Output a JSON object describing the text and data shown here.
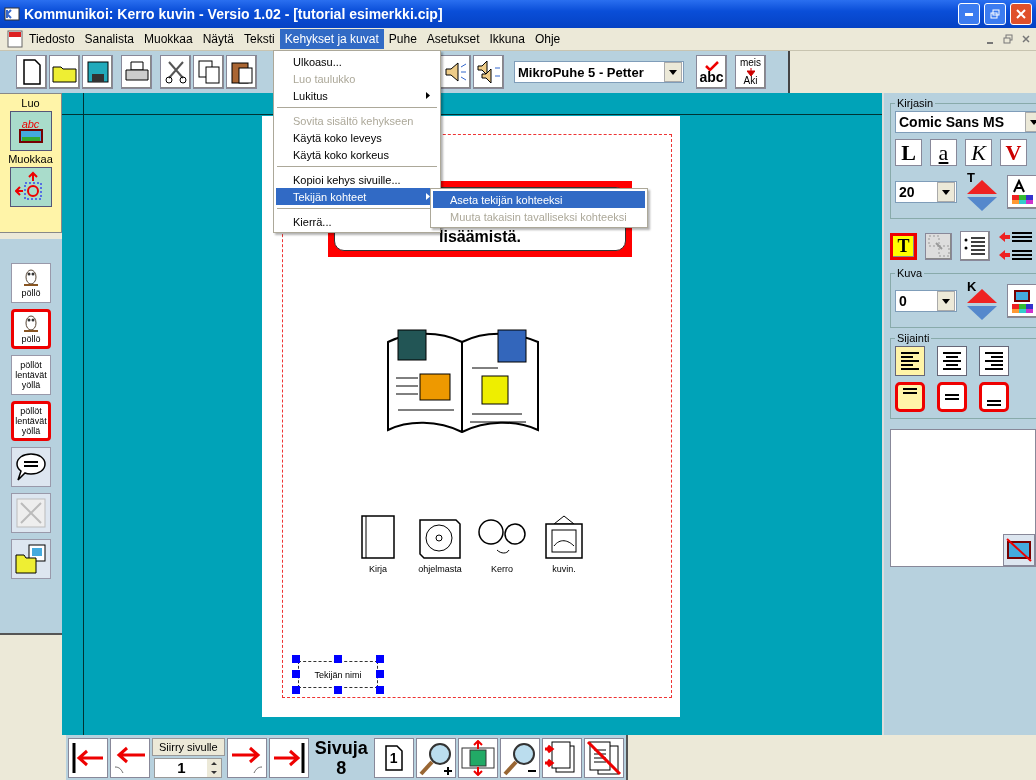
{
  "window": {
    "title": "Kommunikoi: Kerro kuvin - Versio 1.02 - [tutorial esimerkki.cip]"
  },
  "menu_bar": [
    {
      "label": "Tiedosto",
      "selected": false
    },
    {
      "label": "Sanalista",
      "selected": false
    },
    {
      "label": "Muokkaa",
      "selected": false
    },
    {
      "label": "Näytä",
      "selected": false
    },
    {
      "label": "Teksti",
      "selected": false
    },
    {
      "label": "Kehykset ja kuvat",
      "selected": true
    },
    {
      "label": "Puhe",
      "selected": false
    },
    {
      "label": "Asetukset",
      "selected": false
    },
    {
      "label": "Ikkuna",
      "selected": false
    },
    {
      "label": "Ohje",
      "selected": false
    }
  ],
  "toolbar": {
    "voice": "MikroPuhe 5 - Petter",
    "spell_label": "abc",
    "swap_top": "meis",
    "swap_bottom": "Aki"
  },
  "menu": [
    {
      "kind": "item",
      "label": "Ulkoasu...",
      "disabled": false,
      "submenu": false,
      "selected": false
    },
    {
      "kind": "item",
      "label": "Luo taulukko",
      "disabled": true,
      "submenu": false,
      "selected": false
    },
    {
      "kind": "item",
      "label": "Lukitus",
      "disabled": false,
      "submenu": true,
      "selected": false
    },
    {
      "kind": "separator"
    },
    {
      "kind": "item",
      "label": "Sovita sisältö kehykseen",
      "disabled": true,
      "submenu": false,
      "selected": false
    },
    {
      "kind": "item",
      "label": "Käytä koko leveys",
      "disabled": false,
      "submenu": false,
      "selected": false
    },
    {
      "kind": "item",
      "label": "Käytä koko korkeus",
      "disabled": false,
      "submenu": false,
      "selected": false
    },
    {
      "kind": "separator"
    },
    {
      "kind": "item",
      "label": "Kopioi kehys sivuille...",
      "disabled": false,
      "submenu": false,
      "selected": false
    },
    {
      "kind": "item",
      "label": "Tekijän kohteet",
      "disabled": false,
      "submenu": true,
      "selected": true
    },
    {
      "kind": "separator"
    },
    {
      "kind": "item",
      "label": "Kierrä...",
      "disabled": false,
      "submenu": false,
      "selected": false
    }
  ],
  "submenu": [
    {
      "label": "Aseta tekijän kohteeksi",
      "disabled": false,
      "selected": true
    },
    {
      "label": "Muuta takaisin tavalliseksi kohteeksi",
      "disabled": true,
      "selected": false
    }
  ],
  "left_panel": {
    "create_label": "Luo",
    "create_icon_text": "abc",
    "edit_label": "Muokkaa",
    "symbols": [
      {
        "kind": "picture",
        "label": "pöllö",
        "framed": false
      },
      {
        "kind": "picture",
        "label": "pöllö",
        "framed": true
      },
      {
        "kind": "text",
        "label": "pöllöt lentävät yöllä",
        "framed": false
      },
      {
        "kind": "text",
        "label": "pöllöt lentävät yöllä",
        "framed": true
      }
    ]
  },
  "page": {
    "frame_text": "lisäämistä.",
    "symbols": [
      {
        "kind": "book",
        "label": "Kirja"
      },
      {
        "kind": "disc",
        "label": "ohjelmasta"
      },
      {
        "kind": "faces",
        "label": "Kerro"
      },
      {
        "kind": "picture",
        "label": "kuvin."
      }
    ],
    "author_frame": "Tekijän nimi"
  },
  "right_panel": {
    "font_group": "Kirjasin",
    "font": "Comic Sans MS",
    "styles": [
      "L",
      "a",
      "K",
      "V"
    ],
    "size": "20",
    "size_arrow_label": "T",
    "text_frame_label": "T",
    "image_group": "Kuva",
    "image_border": "0",
    "image_arrow_label": "K",
    "position_group": "Sijainti",
    "horizontal": [
      {
        "selected": true
      },
      {
        "selected": false
      },
      {
        "selected": false
      }
    ],
    "vertical": [
      {
        "selected": true
      },
      {
        "selected": false
      },
      {
        "selected": false
      }
    ]
  },
  "bottom_bar": {
    "goto_label": "Siirry sivulle",
    "goto_value": "1",
    "pages_label": "Sivuja",
    "pages_count": "8",
    "page_icon_number": "1"
  }
}
